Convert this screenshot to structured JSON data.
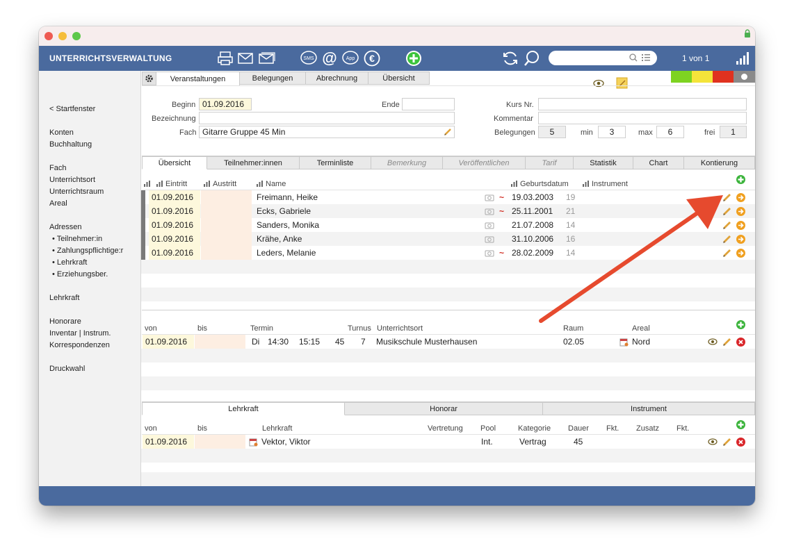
{
  "app": {
    "title": "UNTERRICHTSVERWALTUNG",
    "pager": "1 von 1"
  },
  "colors": {
    "header": "#4a6a9e",
    "green_status": "#7ed321",
    "yellow_status": "#f4e43a",
    "red_status": "#e0321f",
    "date_bg": "#fdf8dc",
    "empty_bg": "#fdeee2",
    "arrow": "#e64a2e"
  },
  "toolbar_icons": [
    "printer-icon",
    "mail-icon",
    "mail-multi-icon",
    "sms-icon",
    "at-icon",
    "app-icon",
    "euro-icon",
    "add-icon",
    "refresh-icon",
    "search-icon"
  ],
  "sidebar": {
    "items": [
      "< Startfenster",
      "Konten",
      "Buchhaltung",
      "Fach",
      "Unterrichtsort",
      "Unterrichtsraum",
      "Areal",
      "Adressen",
      "• Teilnehmer:in",
      "• Zahlungspflichtige:r",
      "• Lehrkraft",
      "• Erziehungsber.",
      "Lehrkraft",
      "Honorare",
      "Inventar | Instrum.",
      "Korrespondenzen",
      "Druckwahl"
    ]
  },
  "top_tabs": [
    "Veranstaltungen",
    "Belegungen",
    "Abrechnung",
    "Übersicht"
  ],
  "form": {
    "beginn_label": "Beginn",
    "beginn_value": "01.09.2016",
    "ende_label": "Ende",
    "ende_value": "",
    "bezeichnung_label": "Bezeichnung",
    "bezeichnung_value": "",
    "fach_label": "Fach",
    "fach_value": "Gitarre Gruppe 45 Min",
    "kurs_label": "Kurs Nr.",
    "kurs_value": "",
    "kommentar_label": "Kommentar",
    "kommentar_value": "",
    "belegungen_label": "Belegungen",
    "belegungen_value": "5",
    "min_label": "min",
    "min_value": "3",
    "max_label": "max",
    "max_value": "6",
    "frei_label": "frei",
    "frei_value": "1"
  },
  "sub_tabs": [
    "Übersicht",
    "Teilnehmer:innen",
    "Terminliste",
    "Bemerkung",
    "Veröffentlichen",
    "Tarif",
    "Statistik",
    "Chart",
    "Kontierung"
  ],
  "participants": {
    "headers": {
      "eintritt": "Eintritt",
      "austritt": "Austritt",
      "name": "Name",
      "geburtsdatum": "Geburtsdatum",
      "instrument": "Instrument"
    },
    "rows": [
      {
        "eintritt": "01.09.2016",
        "austritt": "",
        "name": "Freimann, Heike",
        "tilde": "~",
        "geburtsdatum": "19.03.2003",
        "alter": "19"
      },
      {
        "eintritt": "01.09.2016",
        "austritt": "",
        "name": "Ecks, Gabriele",
        "tilde": "~",
        "geburtsdatum": "25.11.2001",
        "alter": "21"
      },
      {
        "eintritt": "01.09.2016",
        "austritt": "",
        "name": "Sanders, Monika",
        "tilde": "",
        "geburtsdatum": "21.07.2008",
        "alter": "14"
      },
      {
        "eintritt": "01.09.2016",
        "austritt": "",
        "name": "Krähe, Anke",
        "tilde": "",
        "geburtsdatum": "31.10.2006",
        "alter": "16"
      },
      {
        "eintritt": "01.09.2016",
        "austritt": "",
        "name": "Leders, Melanie",
        "tilde": "~",
        "geburtsdatum": "28.02.2009",
        "alter": "14"
      }
    ]
  },
  "schedule": {
    "headers": {
      "von": "von",
      "bis": "bis",
      "termin": "Termin",
      "turnus": "Turnus",
      "ort": "Unterrichtsort",
      "raum": "Raum",
      "areal": "Areal"
    },
    "row": {
      "von": "01.09.2016",
      "bis": "",
      "tag": "Di",
      "start": "14:30",
      "ende": "15:15",
      "dauer": "45",
      "turnus": "7",
      "ort": "Musikschule Musterhausen",
      "raum": "02.05",
      "areal": "Nord"
    }
  },
  "bottom_tabs": [
    "Lehrkraft",
    "Honorar",
    "Instrument"
  ],
  "teacher": {
    "headers": {
      "von": "von",
      "bis": "bis",
      "lehrkraft": "Lehrkraft",
      "vertretung": "Vertretung",
      "pool": "Pool",
      "kategorie": "Kategorie",
      "dauer": "Dauer",
      "fkt1": "Fkt.",
      "zusatz": "Zusatz",
      "fkt2": "Fkt."
    },
    "row": {
      "von": "01.09.2016",
      "bis": "",
      "lehrkraft": "Vektor, Viktor",
      "vertretung": "",
      "pool": "Int.",
      "kategorie": "Vertrag",
      "dauer": "45"
    }
  }
}
